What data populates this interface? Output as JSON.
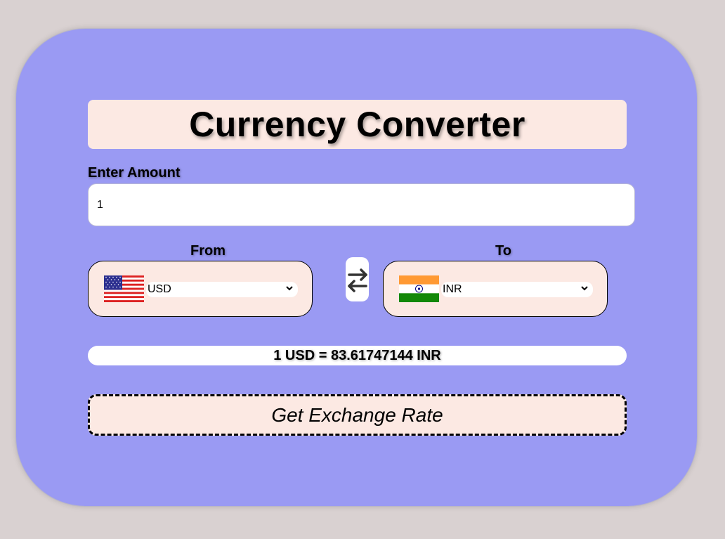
{
  "app": {
    "title": "Currency Converter"
  },
  "amount": {
    "label": "Enter Amount",
    "value": "1"
  },
  "from": {
    "label": "From",
    "selected": "USD",
    "flag_icon": "us-flag-icon"
  },
  "to": {
    "label": "To",
    "selected": "INR",
    "flag_icon": "india-flag-icon"
  },
  "swap": {
    "icon": "swap-arrows-icon"
  },
  "result": {
    "text": "1 USD = 83.61747144 INR"
  },
  "actions": {
    "get_rate_label": "Get Exchange Rate"
  },
  "colors": {
    "page_bg": "#d9d1d1",
    "card_bg": "#9a9af3",
    "panel_bg": "#fce9e3"
  }
}
